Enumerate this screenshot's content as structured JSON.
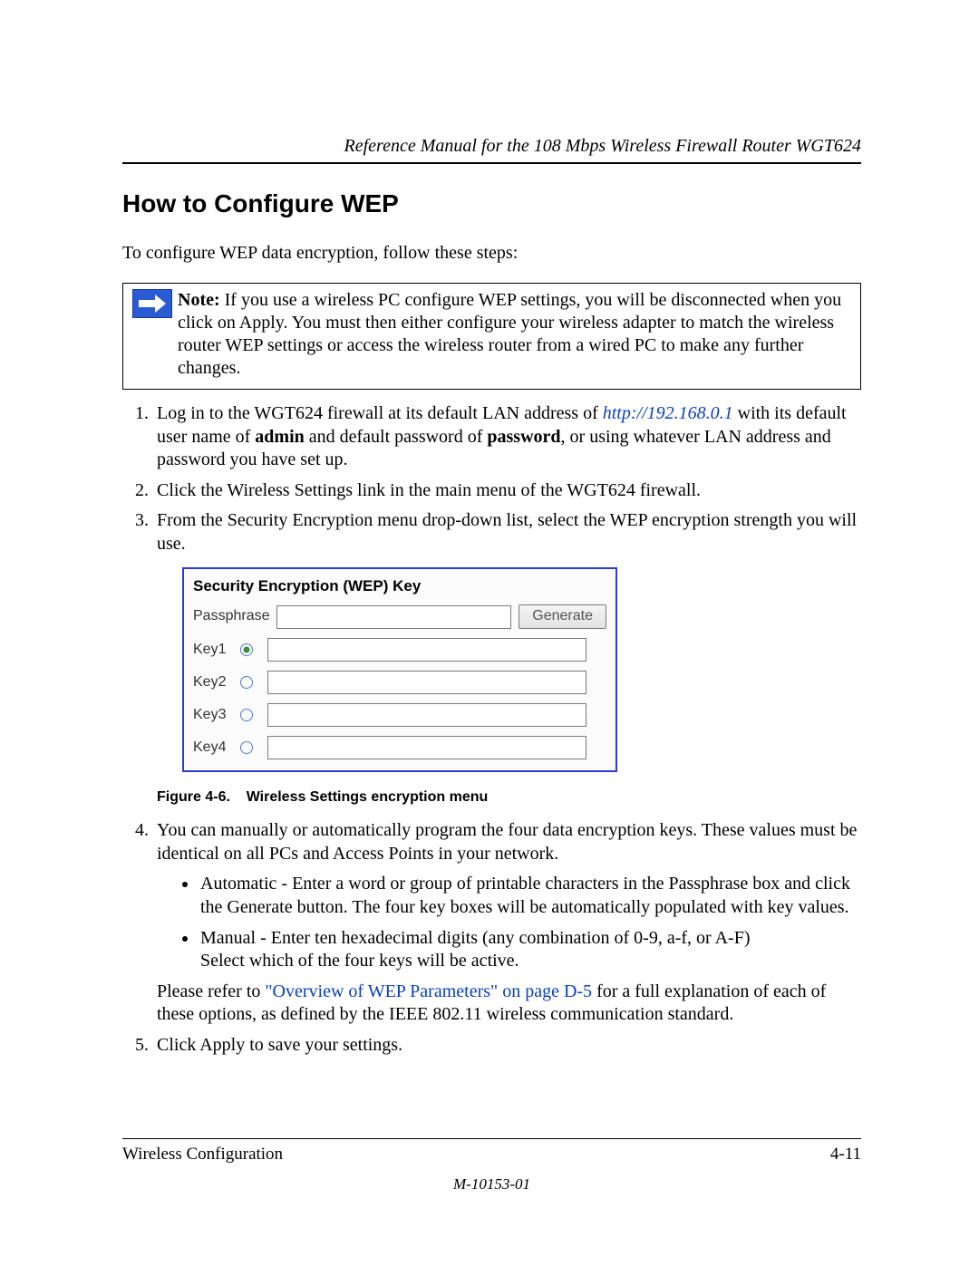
{
  "header": {
    "running_head": "Reference Manual for the 108 Mbps Wireless Firewall Router WGT624"
  },
  "title": "How to Configure WEP",
  "intro": "To configure WEP data encryption, follow these steps:",
  "note": {
    "label": "Note:",
    "text": " If you use a wireless PC configure WEP settings, you will be disconnected when you click on Apply. You must then either configure your wireless adapter to match the wireless router WEP settings or access the wireless router from a wired PC to make any further changes."
  },
  "steps": {
    "s1_a": "Log in to the WGT624 firewall at its default LAN address of ",
    "s1_link": "http://192.168.0.1",
    "s1_b": " with its default user name of ",
    "s1_admin": "admin",
    "s1_c": " and default password of ",
    "s1_password": "password",
    "s1_d": ", or using whatever LAN address and password you have set up.",
    "s2": "Click the Wireless Settings link in the main menu of the WGT624 firewall.",
    "s3": "From the Security Encryption menu drop-down list, select the WEP encryption strength you will use.",
    "s4_a": "You can manually or automatically program the four data encryption keys. These values must be identical on all PCs and Access Points in your network.",
    "s4_b1": "Automatic - Enter a word or group of printable characters in the Passphrase box and click the Generate button. The four key boxes will be automatically populated with key values.",
    "s4_b2_a": "Manual - Enter ten hexadecimal digits (any combination of 0-9, a-f, or A-F)",
    "s4_b2_b": "Select which of the four keys will be active.",
    "s4_c_a": "Please refer to ",
    "s4_c_link": "\"Overview of WEP Parameters\" on page D-5",
    "s4_c_b": " for a full explanation of each of these options, as defined by the IEEE 802.11 wireless communication standard.",
    "s5": "Click Apply to save your settings."
  },
  "figure": {
    "panel_title": "Security Encryption (WEP) Key",
    "passphrase_label": "Passphrase",
    "generate_label": "Generate",
    "keys": [
      "Key1",
      "Key2",
      "Key3",
      "Key4"
    ],
    "selected_key_index": 0,
    "caption_label": "Figure 4-6.",
    "caption_text": "Wireless Settings encryption menu"
  },
  "footer": {
    "left": "Wireless Configuration",
    "right": "4-11",
    "doc_id": "M-10153-01"
  }
}
